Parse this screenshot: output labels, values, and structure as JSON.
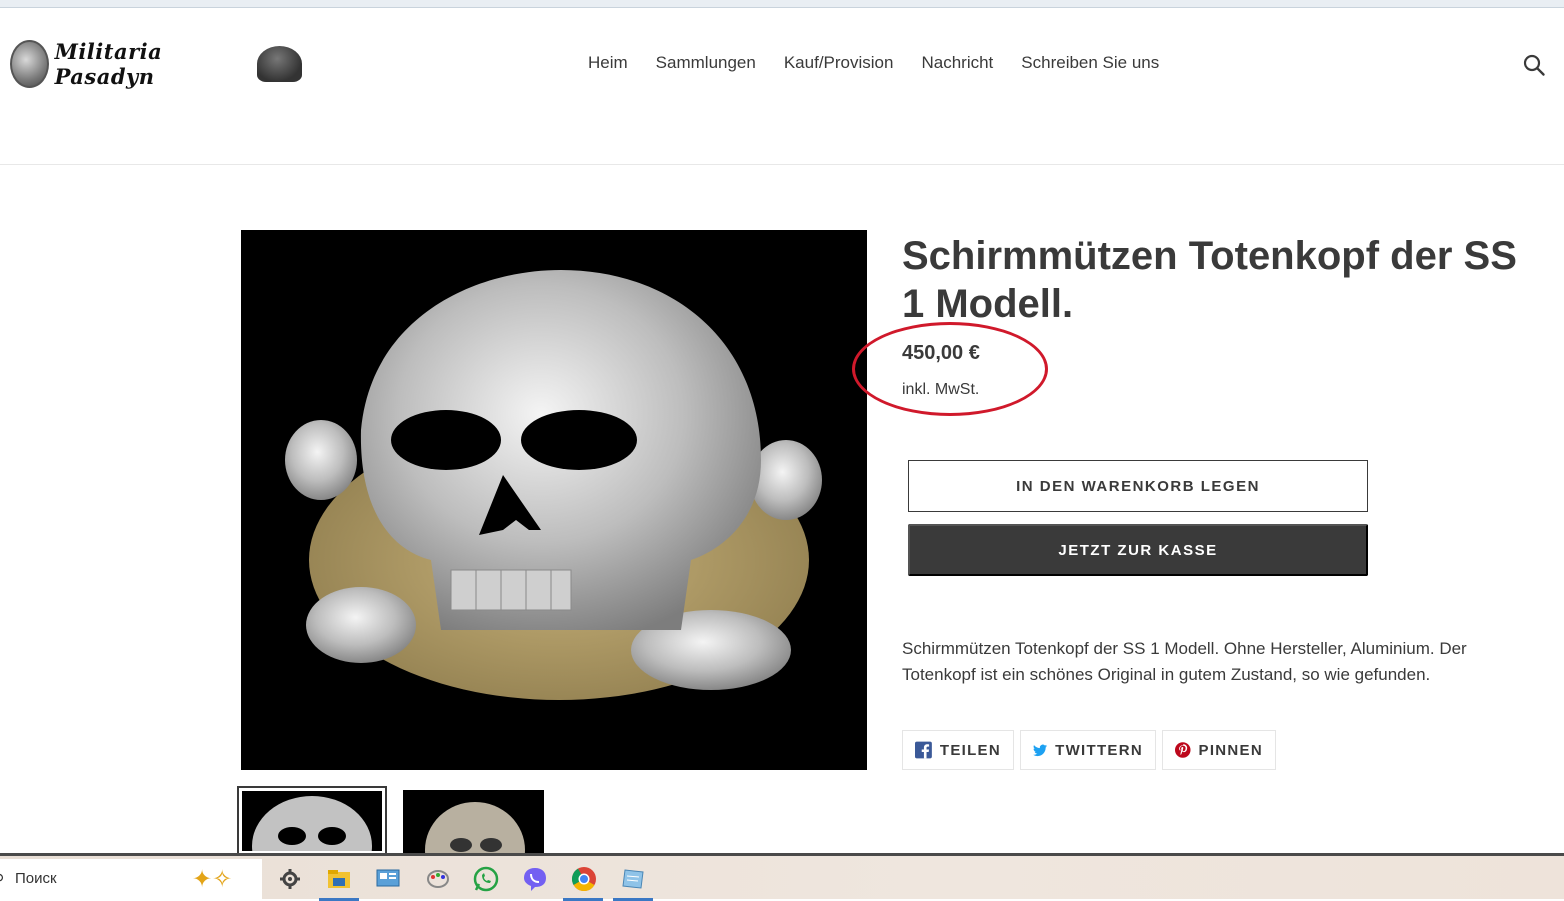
{
  "header": {
    "logo_text": "Militaria Pasadyn",
    "nav": [
      "Heim",
      "Sammlungen",
      "Kauf/Provision",
      "Nachricht",
      "Schreiben Sie uns"
    ],
    "search_icon": "search-icon"
  },
  "product": {
    "title": "Schirmmützen Totenkopf der SS 1 Modell.",
    "price": "450,00 €",
    "tax_note": "inkl. MwSt.",
    "add_to_cart_label": "IN DEN WARENKORB LEGEN",
    "buy_now_label": "JETZT ZUR KASSE",
    "description": "Schirmmützen Totenkopf der SS 1 Modell. Ohne Hersteller, Aluminium. Der Totenkopf ist ein schönes Original in gutem Zustand, so wie gefunden.",
    "share": {
      "facebook_label": "TEILEN",
      "twitter_label": "TWITTERN",
      "pinterest_label": "PINNEN"
    }
  },
  "colors": {
    "text": "#3a3a3a",
    "annotation_circle": "#d0192b",
    "facebook": "#3b5998",
    "twitter": "#1da1f2",
    "pinterest": "#bd081c"
  },
  "taskbar": {
    "search_label": "Поиск",
    "apps": [
      "settings-icon",
      "file-explorer-icon",
      "control-panel-icon",
      "paint-icon",
      "whatsapp-icon",
      "viber-icon",
      "chrome-icon",
      "notes-icon"
    ]
  }
}
